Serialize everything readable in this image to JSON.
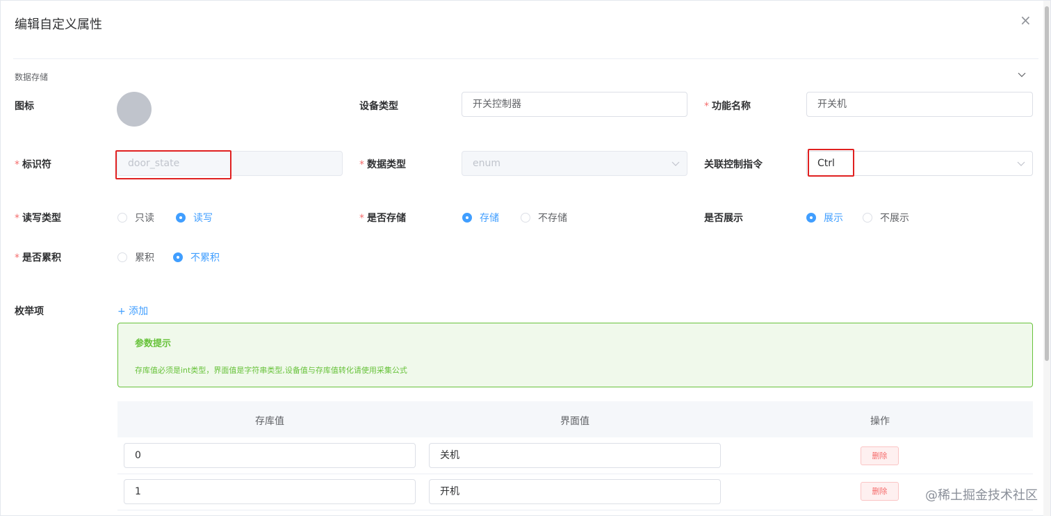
{
  "dialog": {
    "title": "编辑自定义属性",
    "close_glyph": "×"
  },
  "section": {
    "title": "数据存储"
  },
  "fields": {
    "icon_label": "图标",
    "device_type": {
      "label": "设备类型",
      "value": "开关控制器"
    },
    "function_name": {
      "required": "*",
      "label": "功能名称",
      "value": "开关机"
    },
    "identifier": {
      "required": "*",
      "label": "标识符",
      "value": "door_state"
    },
    "data_type": {
      "required": "*",
      "label": "数据类型",
      "value": "enum"
    },
    "control_cmd": {
      "label": "关联控制指令",
      "value": "Ctrl"
    },
    "rw_type": {
      "required": "*",
      "label": "读写类型",
      "options": [
        "只读",
        "读写"
      ],
      "selected": "读写"
    },
    "store": {
      "required": "*",
      "label": "是否存储",
      "options": [
        "存储",
        "不存储"
      ],
      "selected": "存储"
    },
    "display": {
      "label": "是否展示",
      "options": [
        "展示",
        "不展示"
      ],
      "selected": "展示"
    },
    "accumulate": {
      "required": "*",
      "label": "是否累积",
      "options": [
        "累积",
        "不累积"
      ],
      "selected": "不累积"
    }
  },
  "enum": {
    "label": "枚举项",
    "add_text": "+ 添加",
    "alert": {
      "title": "参数提示",
      "desc": "存库值必须是int类型，界面值是字符串类型,设备值与存库值转化请使用采集公式"
    },
    "columns": [
      "存库值",
      "界面值",
      "操作"
    ],
    "rows": [
      {
        "store_value": "0",
        "ui_value": "关机",
        "action": "删除"
      },
      {
        "store_value": "1",
        "ui_value": "开机",
        "action": "删除"
      }
    ]
  },
  "watermark": "@稀土掘金技术社区",
  "colors": {
    "primary": "#409eff",
    "danger": "#f56c6c",
    "success": "#67c23a",
    "highlight": "#e02020"
  }
}
